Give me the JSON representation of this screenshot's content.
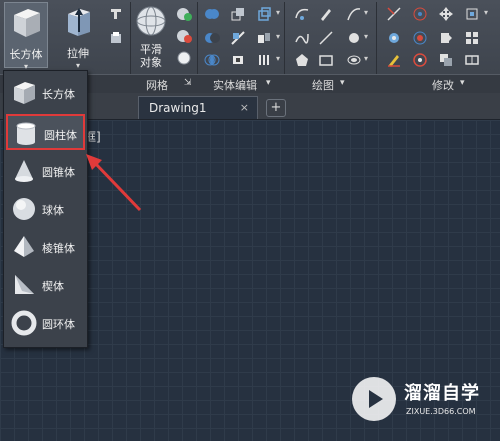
{
  "ribbon": {
    "buttons": {
      "box": "长方体",
      "extrude": "拉伸",
      "smooth_line1": "平滑",
      "smooth_line2": "对象"
    },
    "panels": {
      "mesh": "网格",
      "solid_edit": "实体编辑",
      "draw": "绘图",
      "modify": "修改"
    }
  },
  "tabs": {
    "drawing": "Drawing1",
    "close": "×",
    "new": "+"
  },
  "viewport": {
    "label": "框]"
  },
  "dropdown": {
    "items": [
      {
        "label": "长方体",
        "icon": "box-icon"
      },
      {
        "label": "圆柱体",
        "icon": "cylinder-icon",
        "highlighted": true
      },
      {
        "label": "圆锥体",
        "icon": "cone-icon"
      },
      {
        "label": "球体",
        "icon": "sphere-icon"
      },
      {
        "label": "棱锥体",
        "icon": "pyramid-icon"
      },
      {
        "label": "楔体",
        "icon": "wedge-icon"
      },
      {
        "label": "圆环体",
        "icon": "torus-icon"
      }
    ]
  },
  "watermark": {
    "title": "溜溜自学",
    "url": "ZIXUE.3D66.COM"
  },
  "colors": {
    "highlight": "#e03a3a",
    "canvas": "#263140"
  }
}
